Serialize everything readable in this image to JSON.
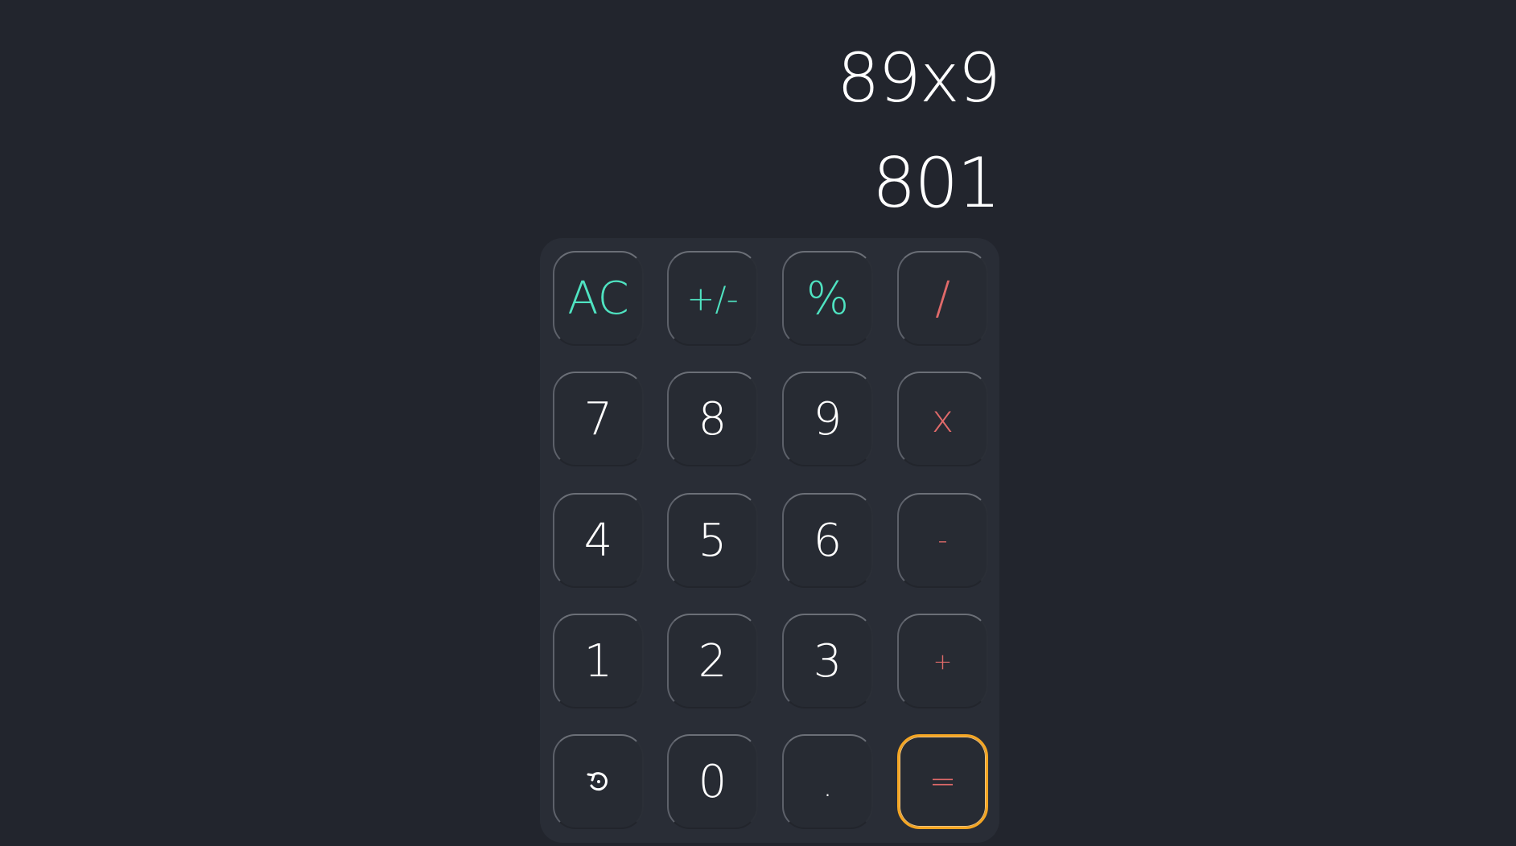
{
  "display": {
    "expression": "89x9",
    "result": "801"
  },
  "keys": {
    "clear": "AC",
    "negate": "+/-",
    "percent": "%",
    "divide": "/",
    "seven": "7",
    "eight": "8",
    "nine": "9",
    "multiply": "x",
    "four": "4",
    "five": "5",
    "six": "6",
    "subtract": "-",
    "one": "1",
    "two": "2",
    "three": "3",
    "add": "+",
    "history_icon": "history-icon",
    "zero": "0",
    "decimal": ".",
    "equals": "="
  },
  "colors": {
    "background": "#22252d",
    "keypad": "#292d36",
    "function_keys": "#4fe3c1",
    "operator_keys": "#e06a6a",
    "equals_border": "#f5a623"
  }
}
